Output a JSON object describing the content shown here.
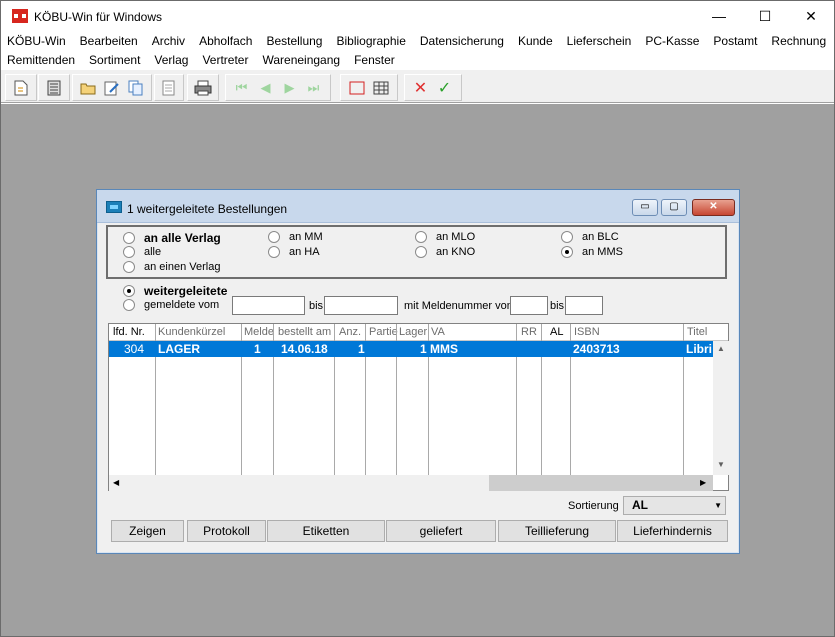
{
  "app": {
    "title": "KÖBU-Win für Windows",
    "minimize": "—",
    "maximize": "☐",
    "close": "✕"
  },
  "menu": {
    "row1": [
      "KÖBU-Win",
      "Bearbeiten",
      "Archiv",
      "Abholfach",
      "Bestellung",
      "Bibliographie",
      "Datensicherung",
      "Kunde",
      "Lieferschein",
      "PC-Kasse",
      "Postamt",
      "Rechnung"
    ],
    "row2": [
      "Remittenden",
      "Sortiment",
      "Verlag",
      "Vertreter",
      "Wareneingang",
      "Fenster"
    ]
  },
  "toolbar": {
    "icons": [
      "new-doc-icon",
      "calculator-icon",
      "folder-open-icon",
      "edit-icon",
      "copy-icon",
      "pages-icon",
      "print-icon",
      "first-record-icon",
      "prev-record-icon",
      "next-record-icon",
      "last-record-icon",
      "frame-icon",
      "grid-icon",
      "cancel-icon",
      "confirm-icon"
    ]
  },
  "dialog": {
    "title": "1 weitergeleitete Bestellungen",
    "btn_min": "▭",
    "btn_max": "▢",
    "btn_close": "✕",
    "options": {
      "an_alle_verlag": "an alle Verlag",
      "alle": "alle",
      "an_einen_verlag": "an einen Verlag",
      "an_mm": "an MM",
      "an_ha": "an HA",
      "an_mlo": "an MLO",
      "an_kno": "an KNO",
      "an_blc": "an BLC",
      "an_mms": "an MMS"
    },
    "weitergeleitete": "weitergeleitete",
    "gemeldete_vom": "gemeldete vom",
    "bis1": "bis",
    "mit_meldenummer": "mit Meldenummer von",
    "bis2": "bis",
    "fields": {
      "date_from": "",
      "date_to": "",
      "nr_from": "",
      "nr_to": ""
    },
    "columns": [
      "lfd. Nr.",
      "Kundenkürzel",
      "Melde",
      "bestellt am",
      "Anz.",
      "Partie",
      "Lager",
      "VA",
      "RR",
      "AL",
      "ISBN",
      "Titel"
    ],
    "rows": [
      {
        "lfd": "304",
        "kunde": "LAGER",
        "melde": "1",
        "datum": "14.06.18",
        "anz": "1",
        "partie": "",
        "lager": "1",
        "va": "MMS",
        "rr": "",
        "al": "",
        "isbn": "2403713",
        "titel": "Libri"
      }
    ],
    "sort_label": "Sortierung",
    "sort_value": "AL",
    "buttons": [
      "Zeigen",
      "Protokoll",
      "Etiketten",
      "geliefert",
      "Teillieferung",
      "Lieferhindernis"
    ]
  },
  "colors": {
    "selection": "#0078d7",
    "workspace": "#a0a0a0"
  }
}
